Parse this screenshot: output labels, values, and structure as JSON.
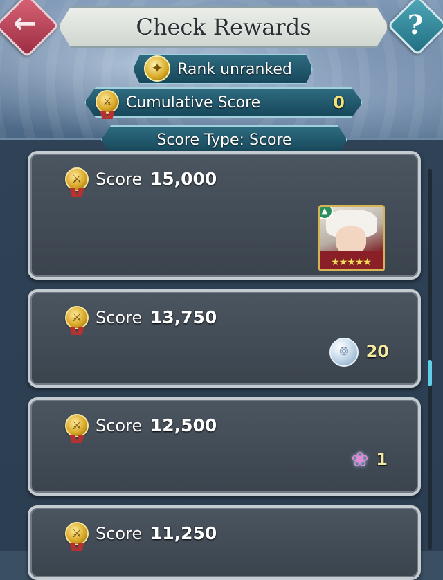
{
  "header": {
    "title": "Check Rewards",
    "back_icon": "back-arrow-icon",
    "help_label": "?"
  },
  "rank": {
    "label": "Rank unranked"
  },
  "cumulative": {
    "label": "Cumulative Score",
    "value": "0"
  },
  "score_type": {
    "label": "Score Type: Score"
  },
  "rewards": [
    {
      "label": "Score",
      "score": "15,000",
      "reward": "hero",
      "stars": "★★★★★"
    },
    {
      "label": "Score",
      "score": "13,750",
      "reward": "orb",
      "count": "20"
    },
    {
      "label": "Score",
      "score": "12,500",
      "reward": "feather",
      "count": "1"
    },
    {
      "label": "Score",
      "score": "11,250"
    }
  ]
}
